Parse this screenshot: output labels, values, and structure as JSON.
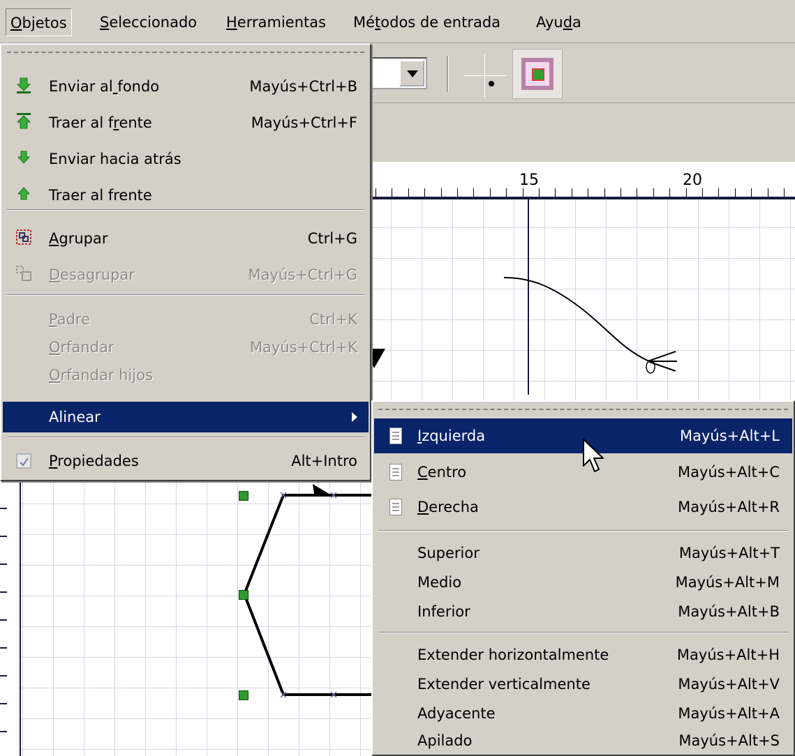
{
  "menubar": {
    "items": [
      {
        "label": "Objetos",
        "mnemonic_index": 0,
        "active": true
      },
      {
        "label": "Seleccionado",
        "mnemonic_index": 0,
        "active": false
      },
      {
        "label": "Herramientas",
        "mnemonic_index": 0,
        "active": false
      },
      {
        "label": "Métodos de entrada",
        "mnemonic_index": 2,
        "active": false
      },
      {
        "label": "Ayuda",
        "mnemonic_index": 3,
        "active": false
      }
    ]
  },
  "ruler": {
    "labels": [
      "15",
      "20"
    ]
  },
  "objects_menu": {
    "items": [
      {
        "label": "Enviar al fondo",
        "mnemonic_index": 9,
        "shortcut": "Mayús+Ctrl+B",
        "icon": "send-to-back-icon",
        "enabled": true
      },
      {
        "label": "Traer al frente",
        "mnemonic_index": 10,
        "shortcut": "Mayús+Ctrl+F",
        "icon": "bring-to-front-icon",
        "enabled": true
      },
      {
        "label": "Enviar hacia atrás",
        "mnemonic_index": -1,
        "shortcut": "",
        "icon": "send-backward-icon",
        "enabled": true
      },
      {
        "label": "Traer al frente",
        "mnemonic_index": -1,
        "shortcut": "",
        "icon": "bring-forward-icon",
        "enabled": true
      },
      {
        "label": "Agrupar",
        "mnemonic_index": 0,
        "shortcut": "Ctrl+G",
        "icon": "group-icon",
        "enabled": true
      },
      {
        "label": "Desagrupar",
        "mnemonic_index": 0,
        "shortcut": "Mayús+Ctrl+G",
        "icon": "ungroup-icon",
        "enabled": false
      },
      {
        "label": "Padre",
        "mnemonic_index": 0,
        "shortcut": "Ctrl+K",
        "icon": "",
        "enabled": false
      },
      {
        "label": "Orfandar",
        "mnemonic_index": 0,
        "shortcut": "Mayús+Ctrl+K",
        "icon": "",
        "enabled": false
      },
      {
        "label": "Orfandar hijos",
        "mnemonic_index": 0,
        "shortcut": "",
        "icon": "",
        "enabled": false
      },
      {
        "label": "Alinear",
        "mnemonic_index": -1,
        "shortcut": "",
        "icon": "",
        "enabled": true,
        "highlighted": true,
        "submenu": true
      },
      {
        "label": "Propiedades",
        "mnemonic_index": 0,
        "shortcut": "Alt+Intro",
        "icon": "properties-icon",
        "enabled": true
      }
    ]
  },
  "align_submenu": {
    "items": [
      {
        "label": "Izquierda",
        "mnemonic_index": 0,
        "shortcut": "Mayús+Alt+L",
        "icon": "align-left-icon",
        "highlighted": true
      },
      {
        "label": "Centro",
        "mnemonic_index": 0,
        "shortcut": "Mayús+Alt+C",
        "icon": "align-center-icon"
      },
      {
        "label": "Derecha",
        "mnemonic_index": 0,
        "shortcut": "Mayús+Alt+R",
        "icon": "align-right-icon"
      },
      {
        "label": "Superior",
        "mnemonic_index": -1,
        "shortcut": "Mayús+Alt+T",
        "icon": ""
      },
      {
        "label": "Medio",
        "mnemonic_index": -1,
        "shortcut": "Mayús+Alt+M",
        "icon": ""
      },
      {
        "label": "Inferior",
        "mnemonic_index": -1,
        "shortcut": "Mayús+Alt+B",
        "icon": ""
      },
      {
        "label": "Extender horizontalmente",
        "mnemonic_index": -1,
        "shortcut": "Mayús+Alt+H",
        "icon": ""
      },
      {
        "label": "Extender verticalmente",
        "mnemonic_index": -1,
        "shortcut": "Mayús+Alt+V",
        "icon": ""
      },
      {
        "label": "Adyacente",
        "mnemonic_index": -1,
        "shortcut": "Mayús+Alt+A",
        "icon": ""
      },
      {
        "label": "Apilado",
        "mnemonic_index": -1,
        "shortcut": "Mayús+Alt+S",
        "icon": ""
      }
    ]
  },
  "colors": {
    "highlight": "#0a246a",
    "menu_bg": "#d4d0c8",
    "handle": "#2e9a2e",
    "disabled_text": "#8c8a85"
  }
}
